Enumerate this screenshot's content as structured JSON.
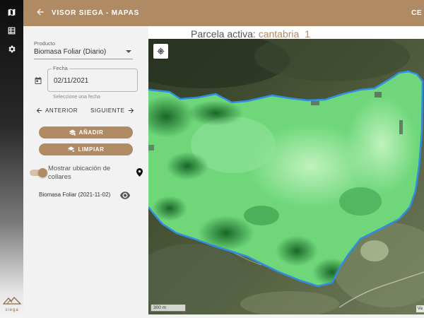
{
  "header": {
    "title": "VISOR SIEGA - MAPAS",
    "right_text": "CE"
  },
  "rail": {
    "items": [
      "map-icon",
      "table-icon",
      "settings-icon"
    ],
    "logo_text": "siega"
  },
  "panel": {
    "product": {
      "label": "Producto",
      "value": "Biomasa Foliar (Diario)"
    },
    "date": {
      "label": "Fecha",
      "value": "02/11/2021",
      "hint": "Seleccione una fecha"
    },
    "nav": {
      "previous": "ANTERIOR",
      "next": "SIGUIENTE"
    },
    "buttons": {
      "add": "AÑADIR",
      "clear": "LIMPIAR"
    },
    "toggle": {
      "label": "Mostrar ubicación de collares",
      "on": true
    },
    "layer": {
      "name": "Biomasa Foliar (2021-11-02)"
    }
  },
  "map": {
    "title_prefix": "Parcela activa: ",
    "parcel_name": "cantabria_1",
    "scale_label": "300 m",
    "attribution": "Va",
    "colors": {
      "brand": "#b08a63",
      "boundary": "#2f8de4",
      "biomass_light": "#7ee08a",
      "biomass_dark": "#0f5a1e"
    }
  }
}
